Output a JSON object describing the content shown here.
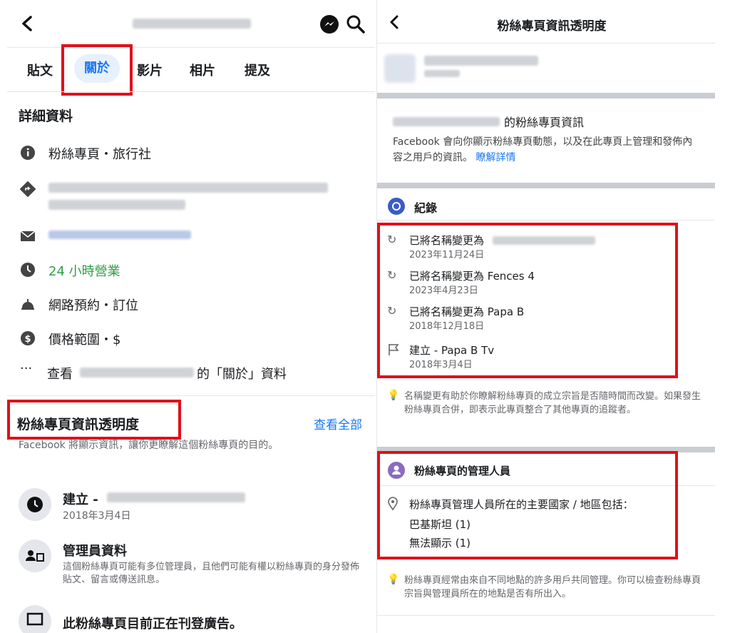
{
  "left": {
    "tabs": [
      "貼文",
      "關於",
      "影片",
      "相片",
      "提及"
    ],
    "details_heading": "詳細資料",
    "category": "粉絲專頁・旅行社",
    "hours": "24 小時營業",
    "booking": "網路預約・訂位",
    "price": "價格範圍・$",
    "see_about_prefix": "查看",
    "see_about_suffix": "的「關於」資料",
    "transparency": {
      "title": "粉絲專頁資訊透明度",
      "see_all": "查看全部",
      "desc": "Facebook 將顯示資訊，讓你更瞭解這個粉絲專頁的目的。",
      "created_label": "建立 -",
      "created_date": "2018年3月4日",
      "admin_title": "管理員資料",
      "admin_desc": "這個粉絲專頁可能有多位管理員，且他們可能有權以粉絲專頁的身分發佈貼文、留言或傳送訊息。",
      "ads_text": "此粉絲專頁目前正在刊登廣告。"
    }
  },
  "right": {
    "header_title": "粉絲專頁資訊透明度",
    "info_title_suffix": "的粉絲專頁資訊",
    "info_desc": "Facebook 會向你顯示粉絲專頁動態，以及在此專頁上管理和發佈內容之用戶的資訊。",
    "learn_more": "瞭解詳情",
    "history_heading": "紀錄",
    "history": [
      {
        "title": "已將名稱變更為",
        "date": "2023年11月24日"
      },
      {
        "title": "已將名稱變更為 Fences 4",
        "date": "2023年4月23日"
      },
      {
        "title": "已將名稱變更為 Papa B",
        "date": "2018年12月18日"
      },
      {
        "title": "建立 - Papa B Tv",
        "date": "2018年3月4日"
      }
    ],
    "history_note": "名稱變更有助於你瞭解粉絲專頁的成立宗旨是否隨時間而改變。如果發生粉絲專頁合併，即表示此專頁整合了其他專頁的追蹤者。",
    "admins_heading": "粉絲專頁的管理人員",
    "admins_intro": "粉絲專頁管理人員所在的主要國家 / 地區包括：",
    "admins_countries": [
      "巴基斯坦 (1)",
      "無法顯示 (1)"
    ],
    "admins_note": "粉絲專頁經常由來自不同地點的許多用戶共同管理。你可以檢查粉絲專頁宗旨與管理員所在的地點是否有所出入。"
  },
  "colors": {
    "highlight_red": "#e0101a",
    "link_blue": "#1877f2",
    "open_green": "#2f9e44",
    "tab_active_bg": "#e7f0fd"
  }
}
